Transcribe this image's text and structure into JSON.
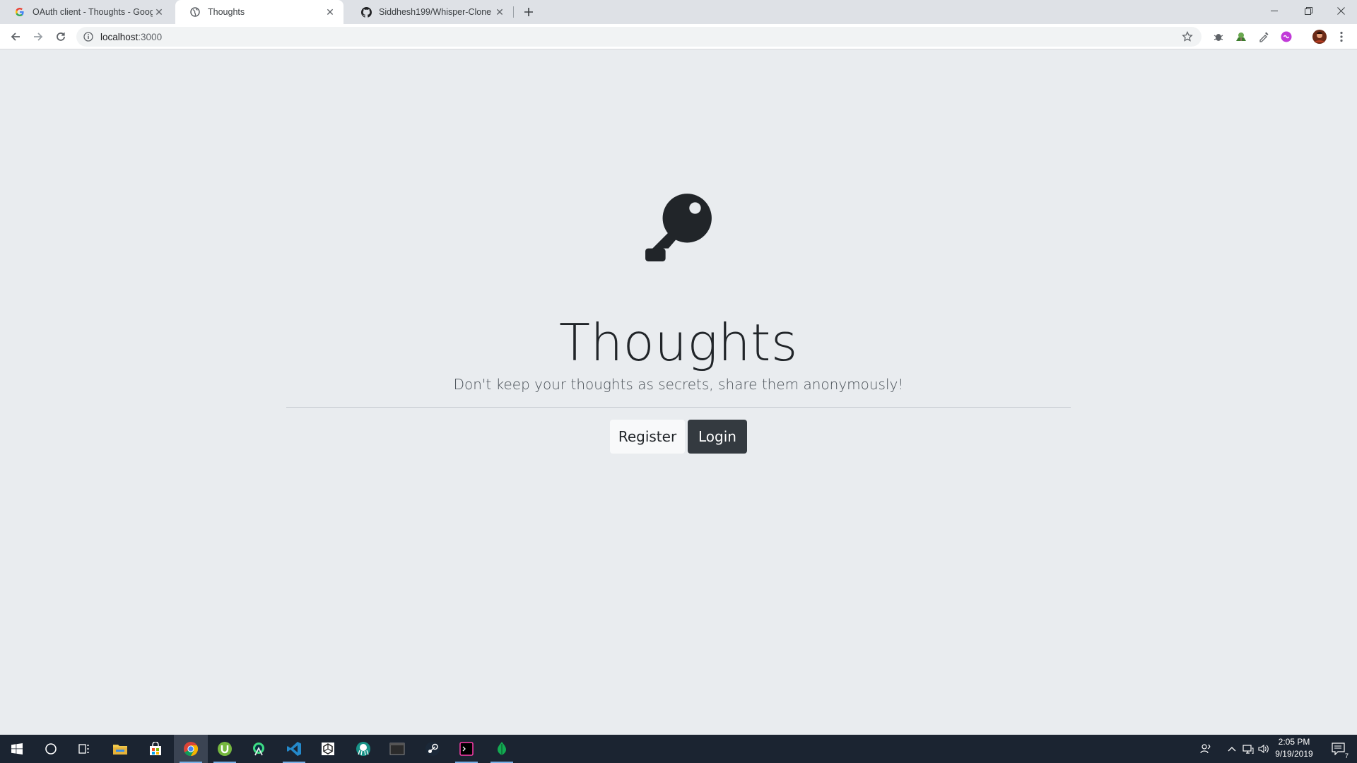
{
  "browser": {
    "tabs": [
      {
        "title": "OAuth client - Thoughts - Google",
        "favicon": "google-g-icon",
        "active": false
      },
      {
        "title": "Thoughts",
        "favicon": "globe-icon",
        "active": true
      },
      {
        "title": "Siddhesh199/Whisper-Clone",
        "favicon": "github-icon",
        "active": false
      }
    ],
    "url_host": "localhost",
    "url_port": ":3000"
  },
  "page": {
    "title": "Thoughts",
    "tagline": "Don't keep your thoughts as secrets, share them anonymously!",
    "register_label": "Register",
    "login_label": "Login",
    "icon": "key-icon"
  },
  "taskbar": {
    "apps": [
      "start-icon",
      "search-icon",
      "task-view-icon",
      "file-explorer-icon",
      "store-icon",
      "chrome-icon",
      "utorrent-icon",
      "android-studio-icon",
      "vscode-icon",
      "unity-icon",
      "gitkraken-icon",
      "terminal-icon",
      "steam-icon",
      "hyper-icon",
      "mongodb-compass-icon"
    ],
    "time": "2:05 PM",
    "date": "9/19/2019",
    "notifications": "7"
  },
  "colors": {
    "page_bg": "#e9ecef",
    "btn_dark": "#343a40",
    "btn_light": "#f8f9fa",
    "taskbar": "#1b2431"
  }
}
